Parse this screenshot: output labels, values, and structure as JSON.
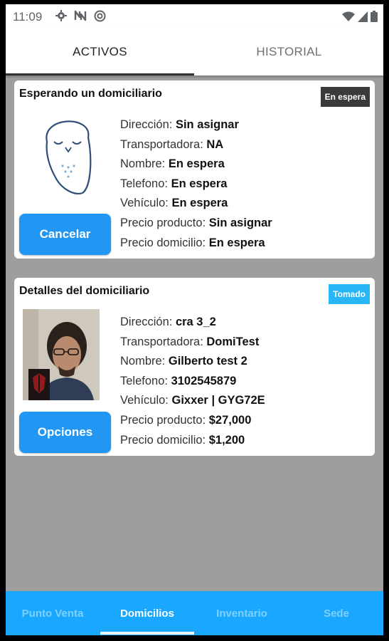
{
  "status_bar": {
    "time": "11:09",
    "left_icons": [
      "gear-icon",
      "n-icon",
      "at-icon"
    ],
    "right_icons": [
      "wifi-icon",
      "signal-icon",
      "battery-icon"
    ]
  },
  "tabs": [
    {
      "label": "ACTIVOS",
      "active": true
    },
    {
      "label": "HISTORIAL",
      "active": false
    }
  ],
  "cards": [
    {
      "title": "Esperando un domiciliario",
      "badge": "En espera",
      "badge_color": "#3a3a3a",
      "button": "Cancelar",
      "rows": [
        {
          "label": "Dirección:",
          "value": "Sin asignar"
        },
        {
          "label": "Transportadora:",
          "value": "NA"
        },
        {
          "label": "Nombre:",
          "value": "En espera"
        },
        {
          "label": "Telefono:",
          "value": "En espera"
        },
        {
          "label": "Vehículo:",
          "value": "En espera"
        },
        {
          "label": "Precio producto:",
          "value": "Sin asignar"
        },
        {
          "label": "Precio domicilio:",
          "value": "En espera"
        }
      ]
    },
    {
      "title": "Detalles del domiciliario",
      "badge": "Tomado",
      "badge_color": "#29b6f6",
      "button": "Opciones",
      "rows": [
        {
          "label": "Dirección:",
          "value": "cra 3_2"
        },
        {
          "label": "Transportadora:",
          "value": "DomiTest"
        },
        {
          "label": "Nombre:",
          "value": "Gilberto test 2"
        },
        {
          "label": "Telefono:",
          "value": "3102545879"
        },
        {
          "label": "Vehículo:",
          "value": "Gixxer | GYG72E"
        },
        {
          "label": "Precio producto:",
          "value": "$27,000"
        },
        {
          "label": "Precio domicilio:",
          "value": "$1,200"
        }
      ]
    }
  ],
  "bottom_nav": [
    {
      "label": "Punto Venta",
      "active": false
    },
    {
      "label": "Domicilios",
      "active": true
    },
    {
      "label": "Inventario",
      "active": false
    },
    {
      "label": "Sede",
      "active": false
    }
  ],
  "colors": {
    "primary_button": "#2196f3",
    "bottom_nav": "#1aa7ff",
    "background": "#9e9e9e"
  }
}
